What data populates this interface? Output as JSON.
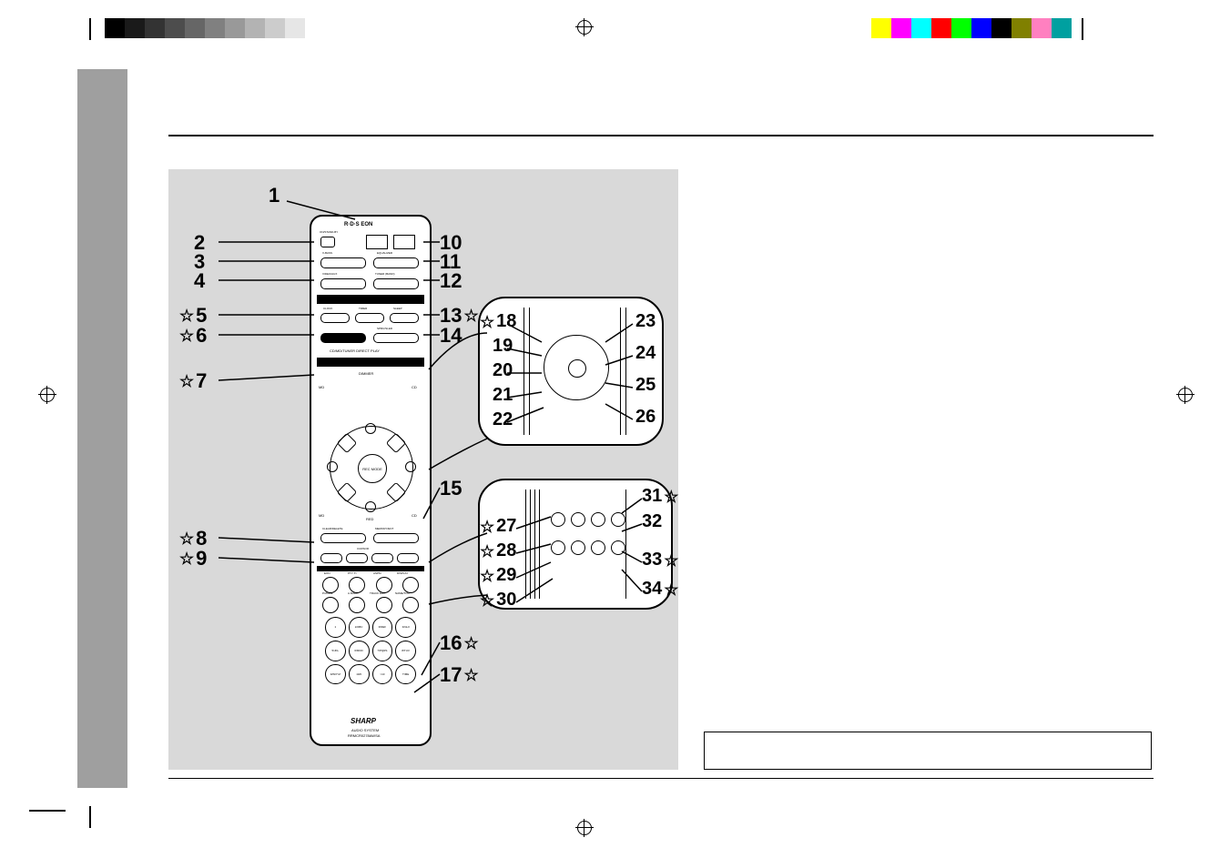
{
  "colorbars": {
    "left": [
      "#000000",
      "#1a1a1a",
      "#333333",
      "#4d4d4d",
      "#666666",
      "#808080",
      "#999999",
      "#b3b3b3",
      "#cccccc",
      "#e6e6e6"
    ],
    "right": [
      "#ffff00",
      "#ff00ff",
      "#00ffff",
      "#ff0000",
      "#00ff00",
      "#0000ff",
      "#000000",
      "#808000",
      "#ff80c0",
      "#00a0a0"
    ]
  },
  "remote": {
    "brand_top": "R·D·S EON",
    "brand_bottom": "SHARP",
    "model_line1": "AUDIO SYSTEM",
    "model_line2": "RRMCR0278AWSA",
    "center_hub": "REC MODE",
    "labels": {
      "on_standby": "ON/STAND-BY",
      "xbass": "X-BASS",
      "equalizer": "EQUALIZER",
      "video_aux": "VIDEO/AUX",
      "tuner_band": "TUNER (BAND)",
      "clock": "CLOCK",
      "timer": "TIMER",
      "sleep": "SLEEP",
      "spru_sled": "SPRU/SLED",
      "direct_play": "CD/MD/TUNER DIRECT PLAY",
      "dimmer": "DIMMER",
      "md_tl": "MD",
      "cd_tr": "CD",
      "md_bl": "MD",
      "cd_br": "CD",
      "red": "RED",
      "clear_delete": "CLEAR/DELETE",
      "memory_ent": "MEMORY/ENT",
      "cursor": "CURSOR",
      "eon": "EON",
      "pty_ti": "PTY·TI",
      "aspm": "ASPM",
      "display": "DISPLAY",
      "pmode": "P.MODE",
      "amark": "A.MARK",
      "track_edit": "TRACK EDIT",
      "name_toc": "NAME/TOC",
      "time": "TIME"
    },
    "keypad": [
      "1",
      "2/ABC",
      "3/DEF",
      "4/GHI",
      "5/JKL",
      "6/MNO",
      "7/PQRS",
      "8/TUV",
      "9/WXYZ",
      "10/0",
      ">10",
      "TIME"
    ]
  },
  "callouts": {
    "left_main": [
      {
        "n": "1",
        "star": false
      },
      {
        "n": "2",
        "star": false
      },
      {
        "n": "3",
        "star": false
      },
      {
        "n": "4",
        "star": false
      },
      {
        "n": "5",
        "star": true
      },
      {
        "n": "6",
        "star": true
      },
      {
        "n": "7",
        "star": true
      },
      {
        "n": "8",
        "star": true
      },
      {
        "n": "9",
        "star": true
      }
    ],
    "right_main_top": [
      {
        "n": "10",
        "star": false
      },
      {
        "n": "11",
        "star": false
      },
      {
        "n": "12",
        "star": false
      },
      {
        "n": "13",
        "star": true
      },
      {
        "n": "14",
        "star": false
      }
    ],
    "right_main_mid": [
      {
        "n": "15",
        "star": false
      }
    ],
    "right_main_bot": [
      {
        "n": "16",
        "star": true
      },
      {
        "n": "17",
        "star": true
      }
    ],
    "inset1_left": [
      {
        "n": "18",
        "star": true
      },
      {
        "n": "19",
        "star": false
      },
      {
        "n": "20",
        "star": false
      },
      {
        "n": "21",
        "star": false
      },
      {
        "n": "22",
        "star": false
      }
    ],
    "inset1_right": [
      {
        "n": "23",
        "star": false
      },
      {
        "n": "24",
        "star": false
      },
      {
        "n": "25",
        "star": false
      },
      {
        "n": "26",
        "star": false
      }
    ],
    "inset2_left": [
      {
        "n": "27",
        "star": true
      },
      {
        "n": "28",
        "star": true
      },
      {
        "n": "29",
        "star": true
      },
      {
        "n": "30",
        "star": true
      }
    ],
    "inset2_right": [
      {
        "n": "31",
        "star": true
      },
      {
        "n": "32",
        "star": false
      },
      {
        "n": "33",
        "star": true
      },
      {
        "n": "34",
        "star": true
      }
    ]
  }
}
